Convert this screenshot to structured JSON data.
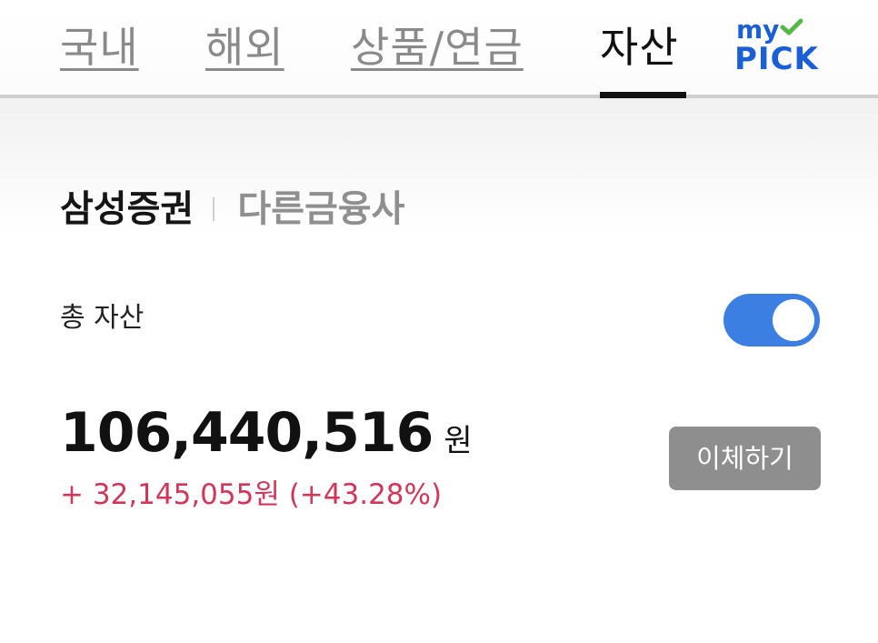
{
  "nav": {
    "tabs": [
      {
        "label": "국내"
      },
      {
        "label": "해외"
      },
      {
        "label": "상품/연금"
      },
      {
        "label": "자산"
      }
    ],
    "active_tab": "자산",
    "logo": {
      "top_text": "my",
      "bottom_text": "PICK",
      "color": "#1a5fd6",
      "check_color": "#57b848",
      "icon": "check-icon"
    }
  },
  "broker_tabs": {
    "items": [
      {
        "label": "삼성증권"
      },
      {
        "label": "다른금융사"
      }
    ],
    "active": "삼성증권"
  },
  "assets": {
    "total_label": "총 자산",
    "toggle_on": true,
    "toggle_color": "#3b7fe3",
    "amount": "106,440,516",
    "unit": "원",
    "change": "+ 32,145,055원 (+43.28%)",
    "change_color": "#d2365a"
  },
  "actions": {
    "transfer_label": "이체하기"
  }
}
